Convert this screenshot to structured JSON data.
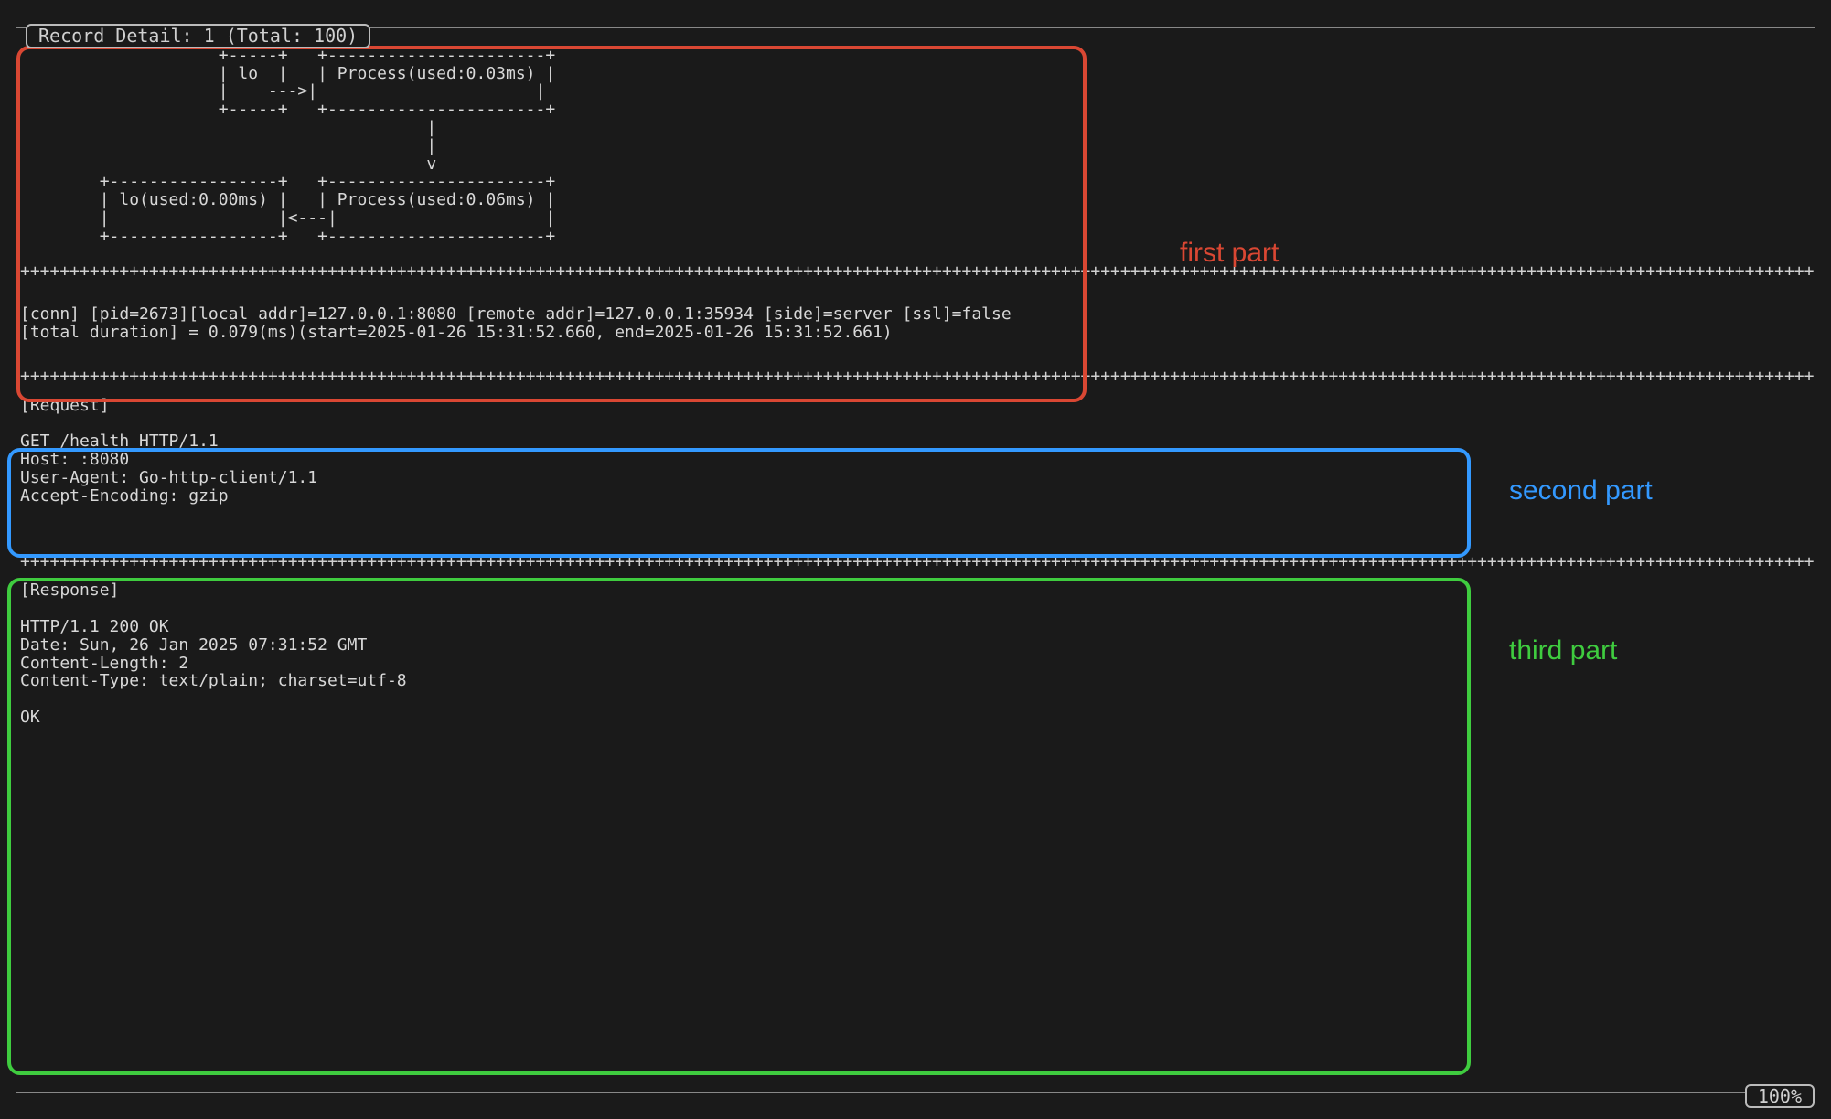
{
  "header": {
    "title": "Record Detail: 1 (Total: 100)"
  },
  "annotations": {
    "first": "first part",
    "second": "second part",
    "third": "third part"
  },
  "diagram": "                    +-----+   +----------------------+\n                    | lo  |   | Process(used:0.03ms) |\n                    |    --->|                      |\n                    +-----+   +----------------------+\n                                         |\n                                         |\n                                         v\n        +-----------------+   +----------------------+\n        | lo(used:0.00ms) |   | Process(used:0.06ms) |\n        |                 |<---|                     |\n        +-----------------+   +----------------------+",
  "separator": "++++++++++++++++++++++++++++++++++++++++++++++++++++++++++++++++++++++++++++++++++++++++++++++++++++++++++++++++++++++++++++++++++++++++++++++++++++++++++++++++++++++++++++++++++++++++++++++++++++++++++++++++++++++++++++++++++++++++++",
  "conn": {
    "line1": "[conn] [pid=2673][local addr]=127.0.0.1:8080 [remote addr]=127.0.0.1:35934 [side]=server [ssl]=false",
    "line2": "[total duration] = 0.079(ms)(start=2025-01-26 15:31:52.660, end=2025-01-26 15:31:52.661)"
  },
  "request": {
    "label": "[Request]",
    "body": "GET /health HTTP/1.1\nHost: :8080\nUser-Agent: Go-http-client/1.1\nAccept-Encoding: gzip"
  },
  "response": {
    "label": "[Response]",
    "body": "HTTP/1.1 200 OK\nDate: Sun, 26 Jan 2025 07:31:52 GMT\nContent-Length: 2\nContent-Type: text/plain; charset=utf-8\n\nOK"
  },
  "footer": {
    "percent": "100%"
  }
}
